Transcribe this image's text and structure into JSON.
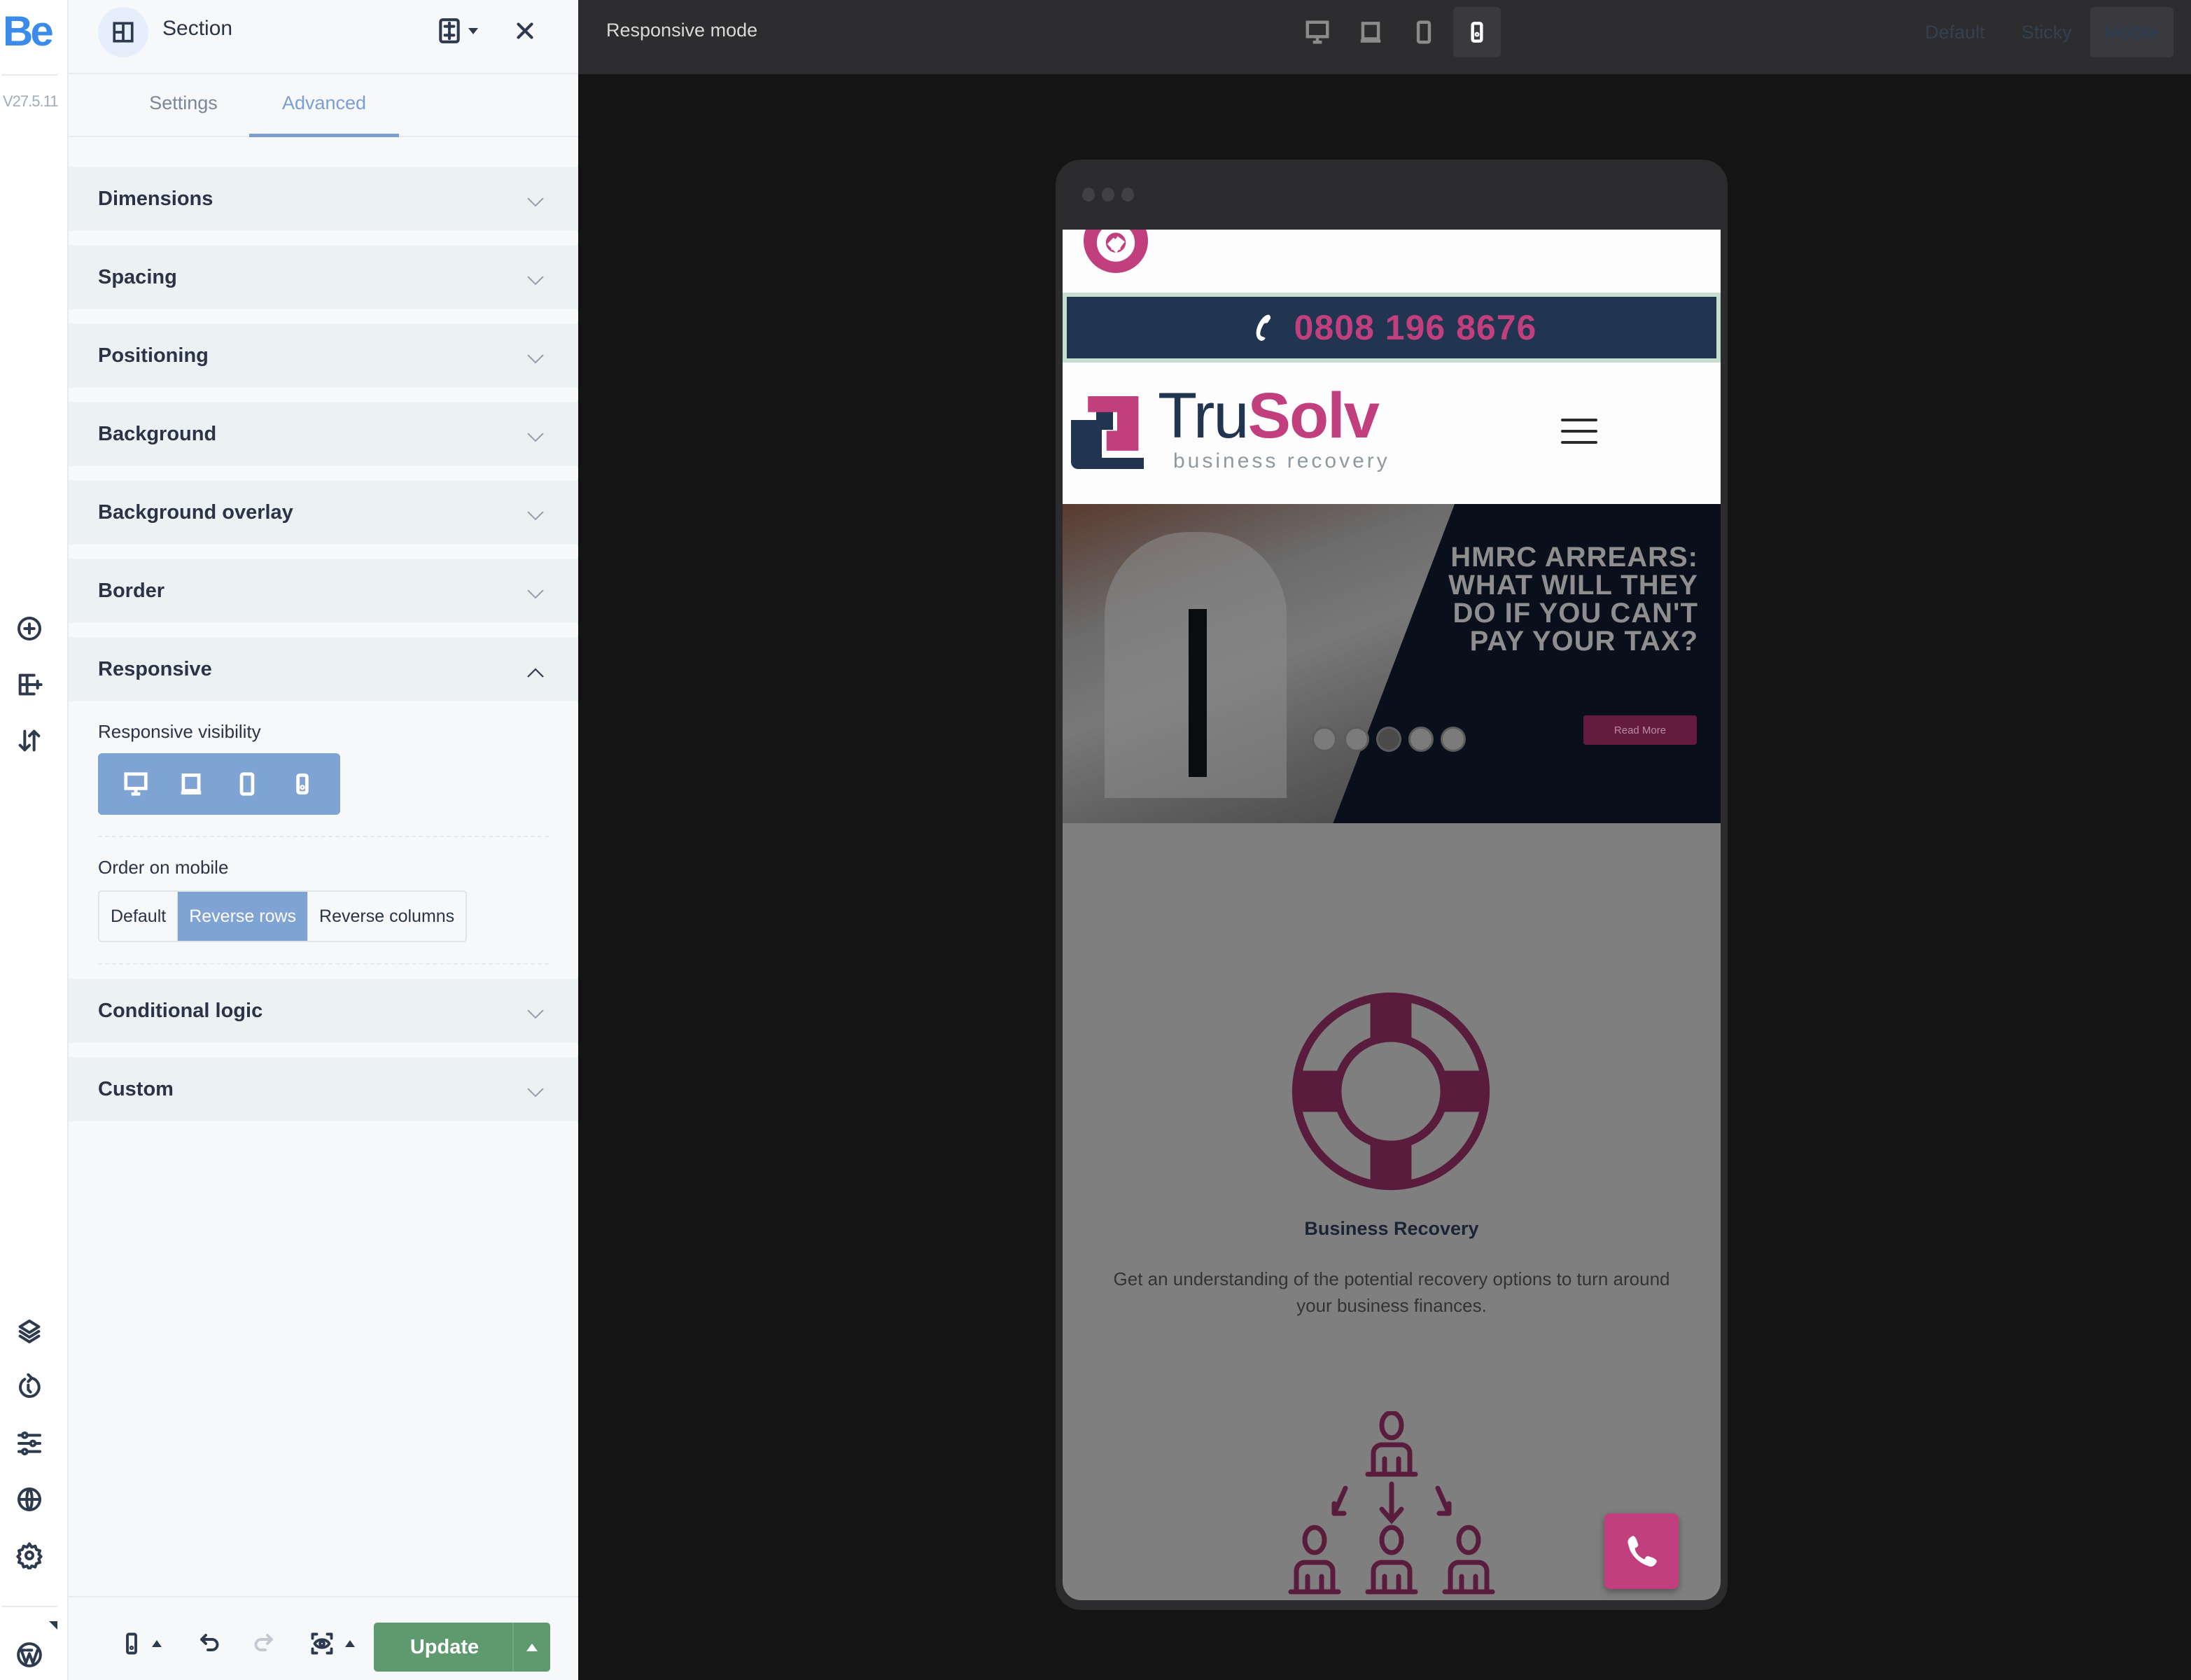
{
  "app": {
    "logo_text": "Be",
    "version": "V27.5.11"
  },
  "rail_icons": [
    "add-element-icon",
    "add-section-icon",
    "sort-icon",
    "layers-icon",
    "history-icon",
    "options-icon",
    "globe-icon",
    "settings-icon",
    "wordpress-icon"
  ],
  "panel": {
    "element_title": "Section",
    "tabs": [
      {
        "label": "Settings",
        "active": false
      },
      {
        "label": "Advanced",
        "active": true
      }
    ],
    "sections": [
      {
        "label": "Dimensions",
        "open": false
      },
      {
        "label": "Spacing",
        "open": false
      },
      {
        "label": "Positioning",
        "open": false
      },
      {
        "label": "Background",
        "open": false
      },
      {
        "label": "Background overlay",
        "open": false
      },
      {
        "label": "Border",
        "open": false
      },
      {
        "label": "Responsive",
        "open": true
      },
      {
        "label": "Conditional logic",
        "open": false
      },
      {
        "label": "Custom",
        "open": false
      }
    ],
    "responsive": {
      "visibility_label": "Responsive visibility",
      "visibility_devices": [
        "desktop",
        "laptop",
        "tablet",
        "mobile"
      ],
      "order_label": "Order on mobile",
      "order_options": [
        {
          "label": "Default",
          "active": false
        },
        {
          "label": "Reverse rows",
          "active": true
        },
        {
          "label": "Reverse columns",
          "active": false
        }
      ]
    },
    "footer": {
      "update_label": "Update"
    }
  },
  "topbar": {
    "mode_label": "Responsive mode",
    "devices": [
      {
        "name": "desktop",
        "active": false
      },
      {
        "name": "laptop",
        "active": false
      },
      {
        "name": "tablet",
        "active": false
      },
      {
        "name": "mobile",
        "active": true
      }
    ],
    "states": [
      {
        "label": "Default",
        "active": false
      },
      {
        "label": "Sticky",
        "active": false
      },
      {
        "label": "Mobile",
        "active": true
      }
    ]
  },
  "preview": {
    "phone_number": "0808 196 8676",
    "brand": {
      "part1": "Tru",
      "part2": "Solv",
      "tagline": "business recovery"
    },
    "hero": {
      "title": "HMRC ARREARS: WHAT WILL THEY DO IF YOU CAN'T PAY YOUR TAX?",
      "button": "Read More",
      "slides": 5,
      "active_slide": 3
    },
    "feature": {
      "title": "Business Recovery",
      "description": "Get an understanding of the potential recovery options to turn around your business finances."
    },
    "colors": {
      "brand_pink": "#c23f7d",
      "brand_navy": "#213550",
      "accent_blue": "#7fa3d2",
      "update_green": "#5e9a6e"
    }
  }
}
